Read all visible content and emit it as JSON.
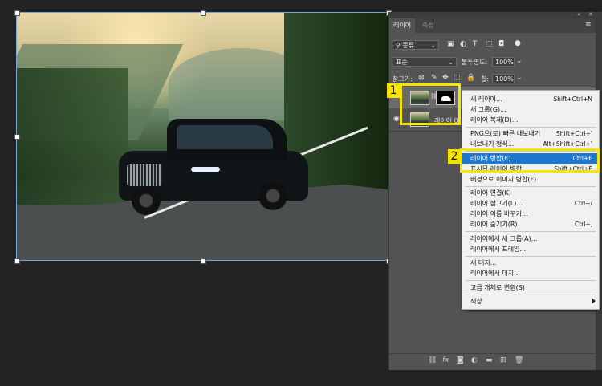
{
  "panel": {
    "tabs": [
      "레이어",
      "속성"
    ],
    "filter_kind": "종류",
    "blend_mode": "표준",
    "opacity_label": "불투명도:",
    "opacity_value": "100%",
    "lock_label": "잠그기:",
    "fill_label": "칠:",
    "fill_value": "100%",
    "layers": [
      {
        "name": "",
        "has_mask": true
      },
      {
        "name": "레이어 0",
        "has_mask": false
      }
    ]
  },
  "context_menu": {
    "items": [
      {
        "label": "새 레이어...",
        "shortcut": "Shift+Ctrl+N"
      },
      {
        "label": "새 그룹(G)...",
        "shortcut": ""
      },
      {
        "label": "레이어 복제(D)...",
        "shortcut": ""
      },
      {
        "label": "PNG으(로) 빠른 내보내기",
        "shortcut": "Shift+Ctrl+'"
      },
      {
        "label": "내보내기 형식...",
        "shortcut": "Alt+Shift+Ctrl+'"
      },
      {
        "label": "레이어 병합(E)",
        "shortcut": "Ctrl+E"
      },
      {
        "label": "표시된 레이어 병합",
        "shortcut": "Shift+Ctrl+E"
      },
      {
        "label": "배경으로 이미지 병합(F)",
        "shortcut": ""
      },
      {
        "label": "레이어 연결(K)",
        "shortcut": ""
      },
      {
        "label": "레이어 잠그기(L)...",
        "shortcut": "Ctrl+/"
      },
      {
        "label": "레이어 이름 바꾸기...",
        "shortcut": ""
      },
      {
        "label": "레이어 숨기기(R)",
        "shortcut": "Ctrl+,"
      },
      {
        "label": "레이어에서 새 그룹(A)...",
        "shortcut": ""
      },
      {
        "label": "레이어에서 프레임...",
        "shortcut": ""
      },
      {
        "label": "새 대지...",
        "shortcut": ""
      },
      {
        "label": "레이어에서 대지...",
        "shortcut": ""
      },
      {
        "label": "고급 개체로 변환(S)",
        "shortcut": ""
      },
      {
        "label": "색상",
        "shortcut": ""
      }
    ]
  },
  "annotations": {
    "step1": "1",
    "step2": "2"
  },
  "colors": {
    "highlight": "#1e78d2",
    "annotation": "#f5e400",
    "panel_bg": "#535353",
    "workspace": "#232323"
  }
}
